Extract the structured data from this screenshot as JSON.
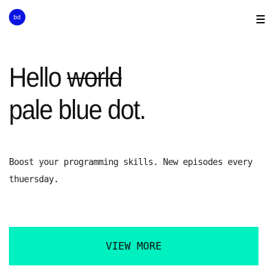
{
  "header": {
    "logo_text": "bd",
    "logo_color": "#0a14e0",
    "menu_icon": "hamburger-menu-icon"
  },
  "hero": {
    "greeting": "Hello",
    "struck_word": "world",
    "second_line": "pale blue dot.",
    "description": "Boost your programming skills. New episodes every thuersday."
  },
  "cta": {
    "label": "VIEW MORE",
    "color": "#00f0bf"
  }
}
